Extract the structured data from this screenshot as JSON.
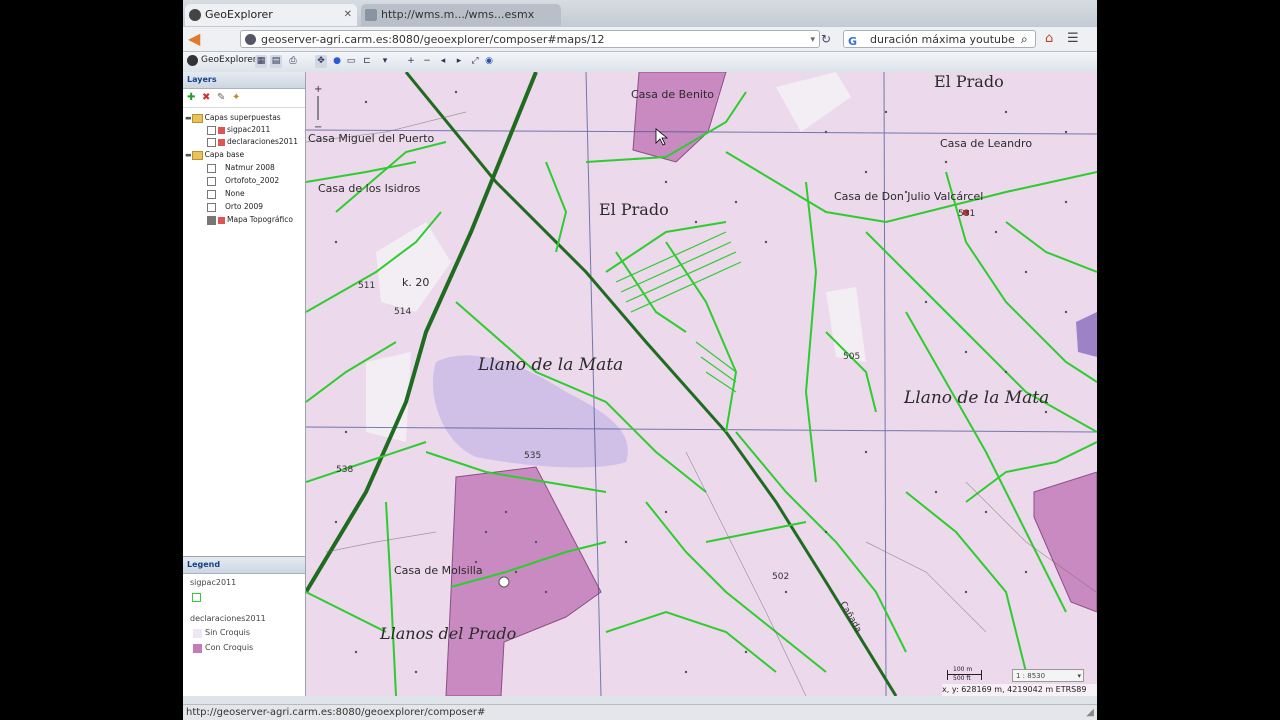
{
  "browser": {
    "tabs": [
      {
        "label": "GeoExplorer",
        "active": true
      },
      {
        "label": "http://wms.m.../wms...esmx",
        "active": false
      }
    ],
    "url": "geoserver-agri.carm.es:8080/geoexplorer/composer#maps/12",
    "search_value": "duración máxima youtube",
    "status_url": "http://geoserver-agri.carm.es:8080/geoexplorer/composer#"
  },
  "app": {
    "title": "GeoExplorer"
  },
  "layers_panel": {
    "title": "Layers",
    "groups": [
      {
        "label": "Capas superpuestas",
        "items": [
          {
            "label": "sigpac2011"
          },
          {
            "label": "declaraciones2011"
          }
        ]
      },
      {
        "label": "Capa base",
        "items": [
          {
            "label": "Natmur 2008"
          },
          {
            "label": "Ortofoto_2002"
          },
          {
            "label": "None"
          },
          {
            "label": "Orto 2009"
          },
          {
            "label": "Mapa Topográfico"
          }
        ]
      }
    ]
  },
  "legend_panel": {
    "title": "Legend",
    "layer1": "sigpac2011",
    "layer2": "declaraciones2011",
    "entry1": "Sin Croquis",
    "entry2": "Con Croquis",
    "colors": {
      "sigpac_outline": "#33cc33",
      "sin_croquis": "#efe6f4",
      "con_croquis": "#c77bb5"
    }
  },
  "map": {
    "labels": {
      "el_prado_top": "El Prado",
      "casa_benito": "Casa de Benito",
      "casa_leandro": "Casa de Leandro",
      "miguel_puerto": "Casa Miguel del Puerto",
      "casa_isidros": "Casa de los Isidros",
      "el_prado_mid": "El Prado",
      "casa_julio": "Casa de Don Julio Valcárcel",
      "km": "k. 20",
      "llano_mata_1": "Llano de la Mata",
      "llano_mata_2": "Llano de la Mata",
      "casa_molsilla": "Casa de Molsilla",
      "llanos_prado": "Llanos del Prado",
      "canada": "Cañada",
      "h531": "531",
      "h511": "511",
      "h514": "514",
      "h505": "505",
      "h535": "535",
      "h538": "538",
      "h502": "502"
    },
    "scale_top": "100 m",
    "scale_bottom": "500 ft",
    "scale_select": "1 : 8530",
    "coords": "x, y: 628169 m, 4219042 m ETRS89"
  }
}
